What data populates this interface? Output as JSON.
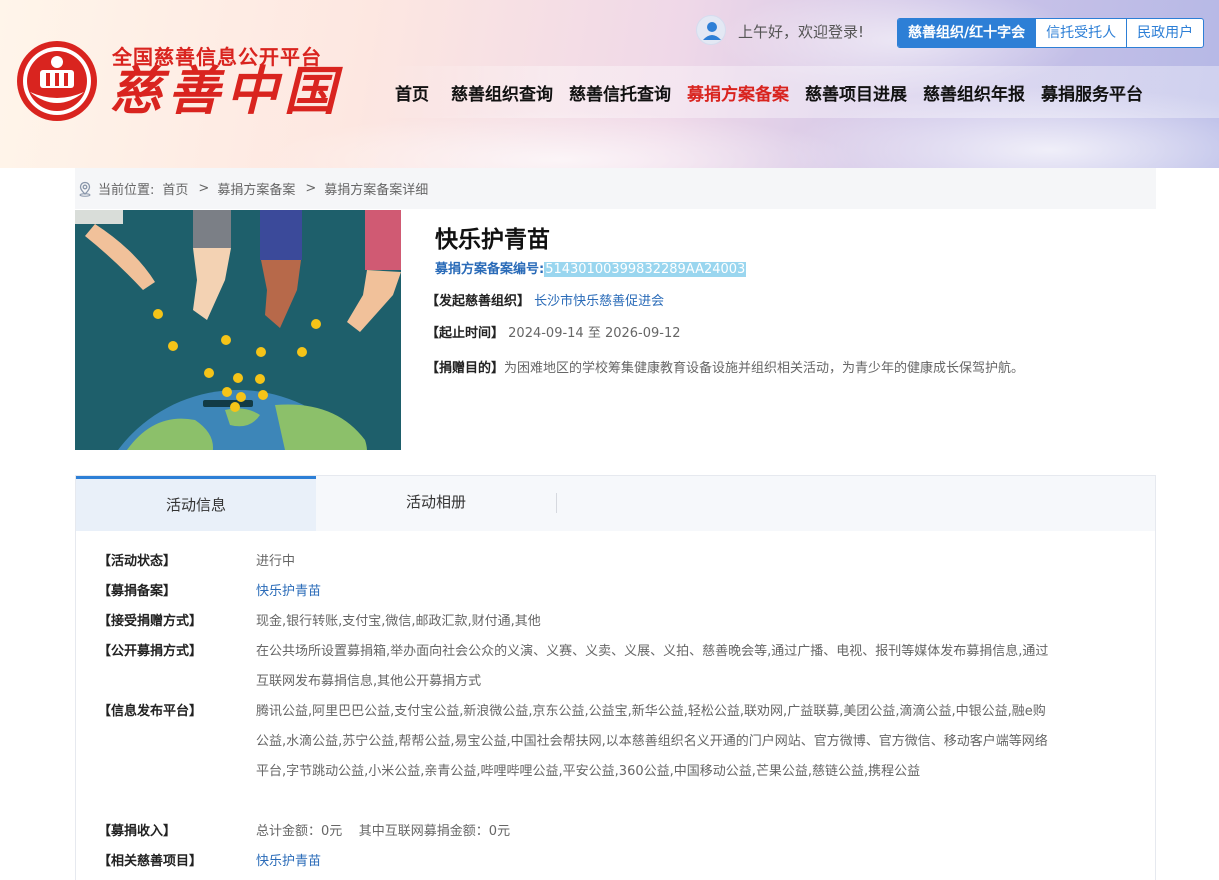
{
  "header": {
    "brand_small": "全国慈善信息公开平台",
    "brand_big": "慈善中国",
    "greeting": "上午好，欢迎登录!",
    "login_tabs": [
      "慈善组织/红十字会",
      "信托受托人",
      "民政用户"
    ],
    "nav": [
      "首页",
      "慈善组织查询",
      "慈善信托查询",
      "募捐方案备案",
      "慈善项目进展",
      "慈善组织年报",
      "募捐服务平台"
    ],
    "active_nav": "募捐方案备案"
  },
  "breadcrumb": {
    "prefix": "当前位置:",
    "items": [
      "首页",
      "募捐方案备案",
      "募捐方案备案详细"
    ]
  },
  "project": {
    "title": "快乐护青苗",
    "no_label": "募捐方案备案编号:",
    "no_value": "51430100399832289AA24003",
    "org_label": "【发起慈善组织】",
    "org_value": "长沙市快乐慈善促进会",
    "time_label": "【起止时间】",
    "time_value": "2024-09-14 至 2026-09-12",
    "purpose_label": "【捐赠目的】",
    "purpose_value": "为困难地区的学校筹集健康教育设备设施并组织相关活动，为青少年的健康成长保驾护航。"
  },
  "tabs": [
    "活动信息",
    "活动相册"
  ],
  "details": [
    {
      "label": "【活动状态】",
      "value": "进行中"
    },
    {
      "label": "【募捐备案】",
      "value": "快乐护青苗"
    },
    {
      "label": "【接受捐赠方式】",
      "value": "现金,银行转账,支付宝,微信,邮政汇款,财付通,其他"
    },
    {
      "label": "【公开募捐方式】",
      "value": "在公共场所设置募捐箱,举办面向社会公众的义演、义赛、义卖、义展、义拍、慈善晚会等,通过广播、电视、报刊等媒体发布募捐信息,通过互联网发布募捐信息,其他公开募捐方式"
    },
    {
      "label": "【信息发布平台】",
      "value": "腾讯公益,阿里巴巴公益,支付宝公益,新浪微公益,京东公益,公益宝,新华公益,轻松公益,联劝网,广益联募,美团公益,滴滴公益,中银公益,融e购公益,水滴公益,苏宁公益,帮帮公益,易宝公益,中国社会帮扶网,以本慈善组织名义开通的门户网站、官方微博、官方微信、移动客户端等网络平台,字节跳动公益,小米公益,亲青公益,哔哩哔哩公益,平安公益,360公益,中国移动公益,芒果公益,慈链公益,携程公益"
    },
    {
      "label": "【募捐收入】",
      "value": "总计金额：0元    其中互联网募捐金额：0元"
    },
    {
      "label": "【相关慈善项目】",
      "value": "快乐护青苗"
    }
  ],
  "colors": {
    "brand_red": "#d9241f",
    "accent_blue": "#2d7fd6",
    "link_blue": "#2a6bb8"
  }
}
